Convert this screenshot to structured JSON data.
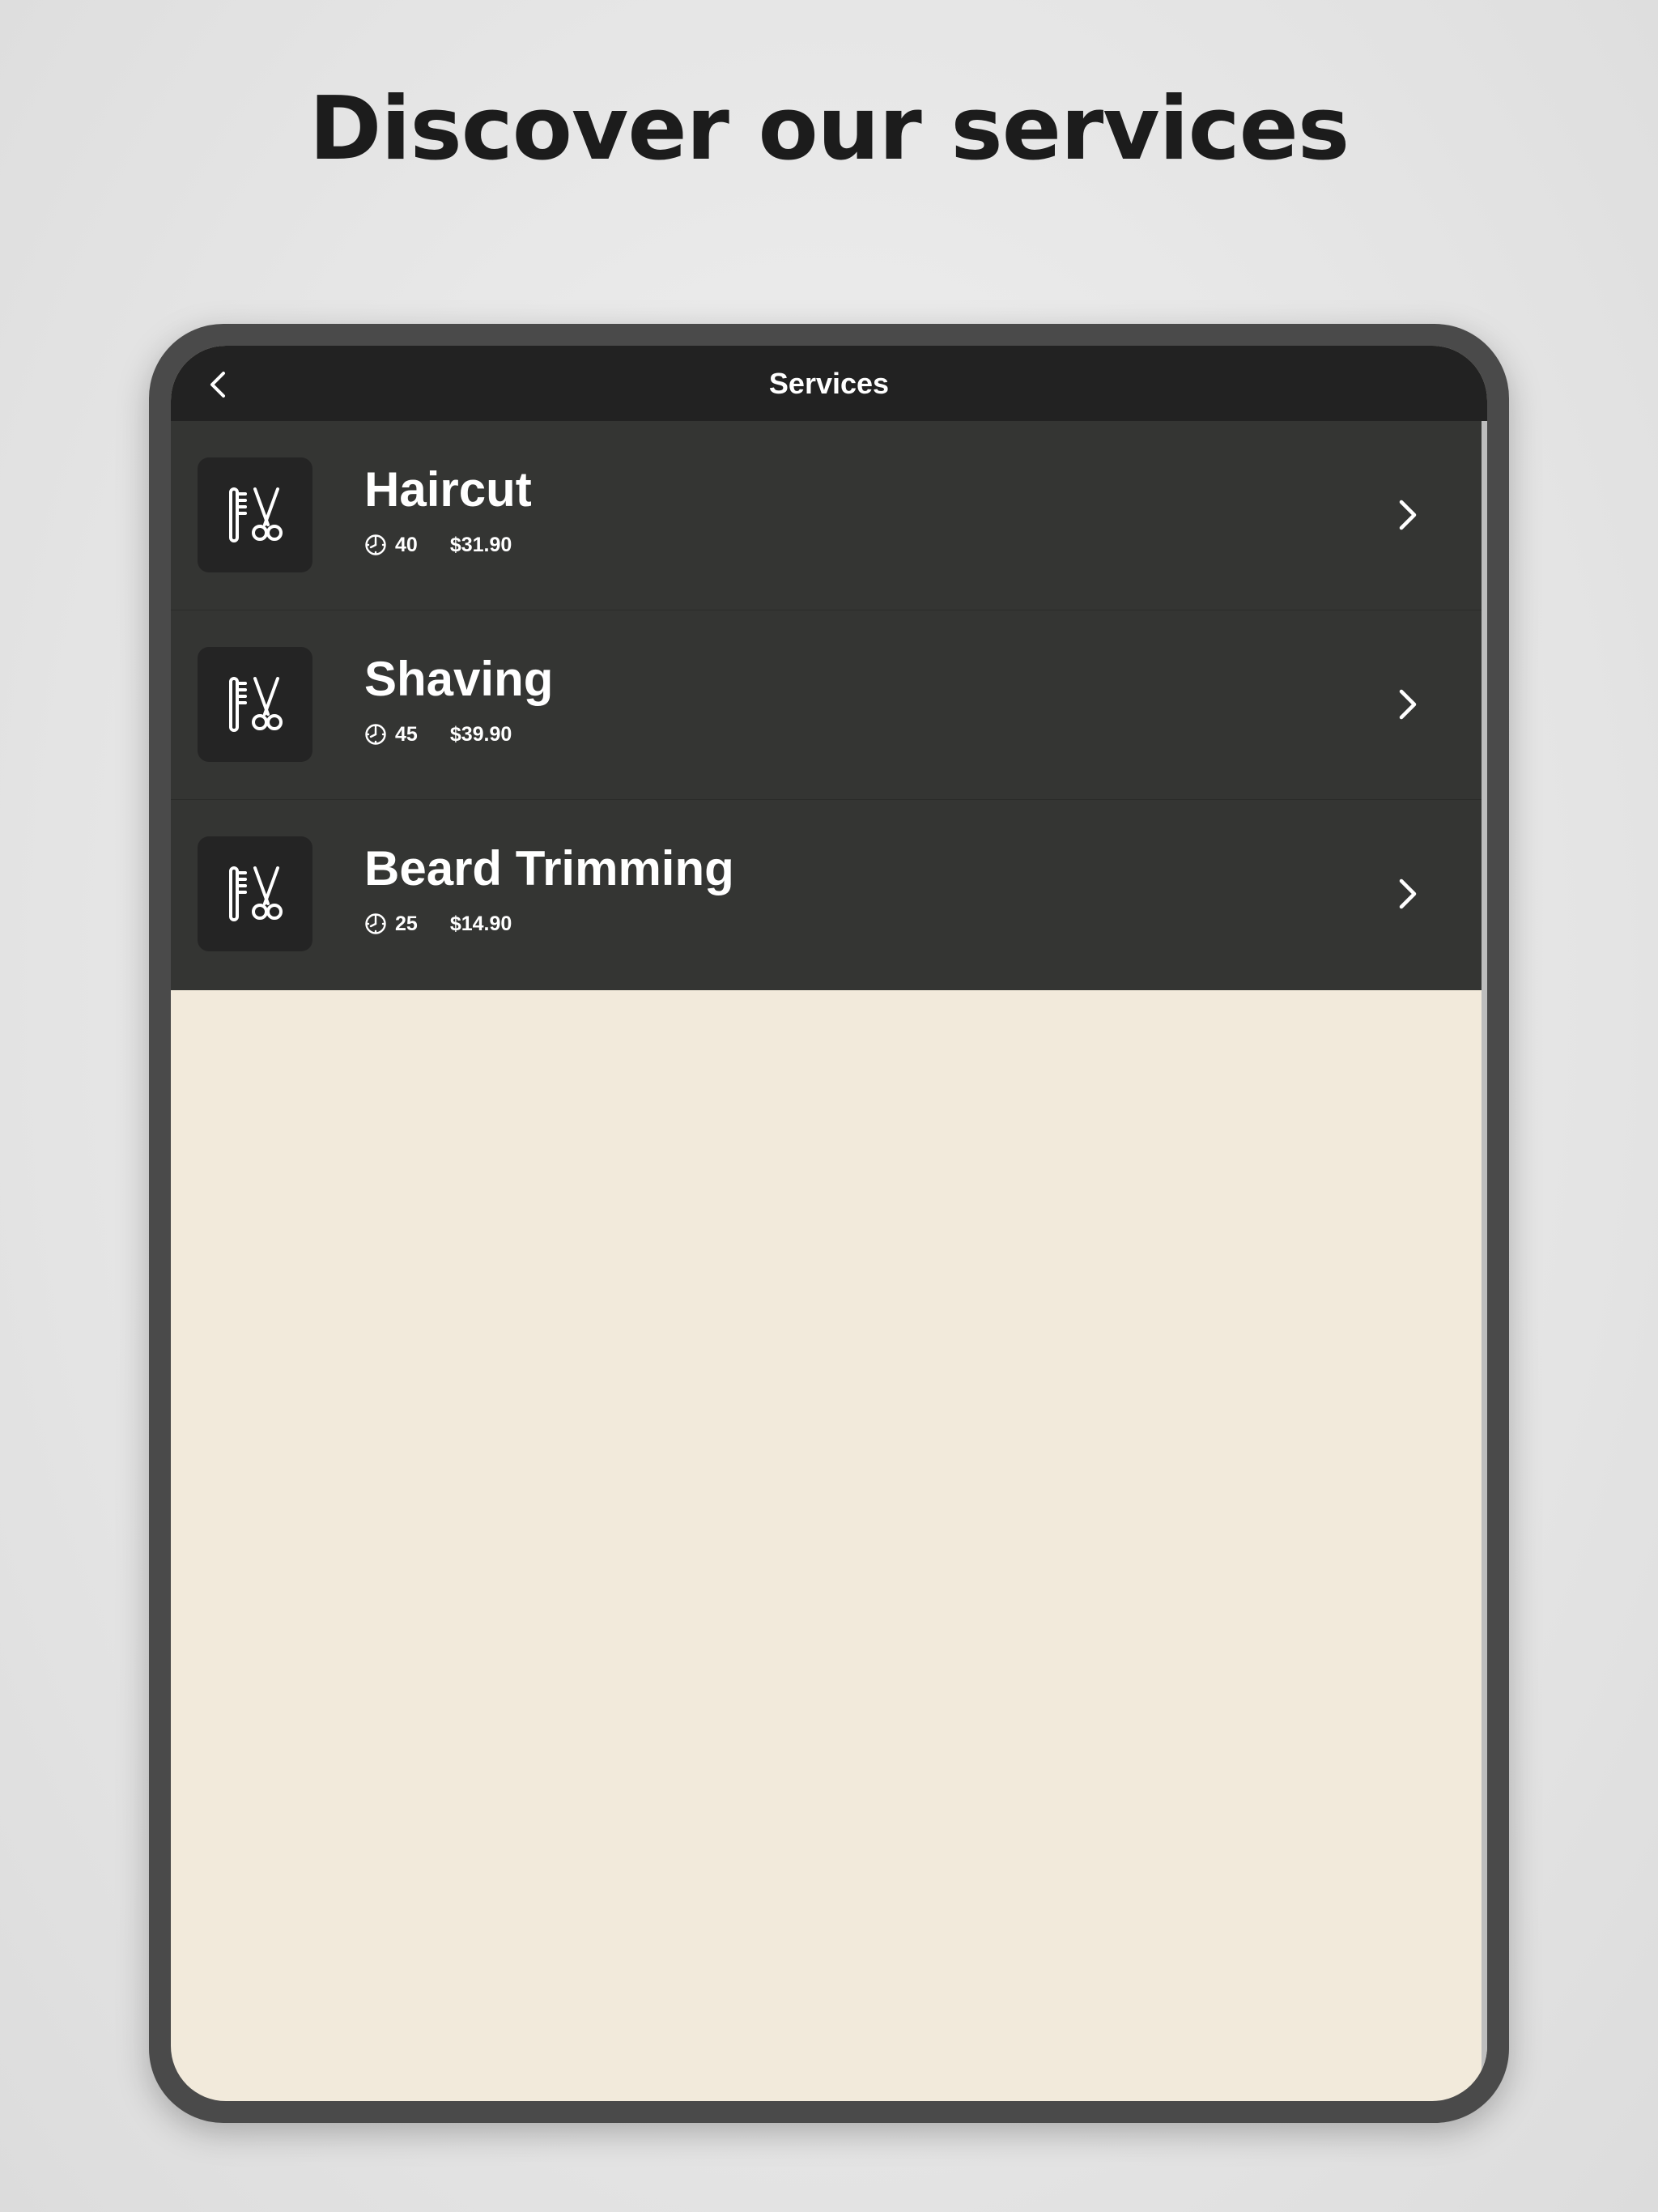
{
  "headline": "Discover our services",
  "navbar": {
    "title": "Services",
    "back_icon": "chevron-left-icon"
  },
  "services": [
    {
      "name": "Haircut",
      "duration": "40",
      "price": "$31.90",
      "icon": "comb-scissors-icon"
    },
    {
      "name": "Shaving",
      "duration": "45",
      "price": "$39.90",
      "icon": "comb-scissors-icon"
    },
    {
      "name": "Beard Trimming",
      "duration": "25",
      "price": "$14.90",
      "icon": "comb-scissors-icon"
    }
  ],
  "colors": {
    "navbar": "#222222",
    "row": "#343533",
    "thumb": "#242424",
    "screen_bg": "#f2eadb",
    "frame": "#4a4a4a"
  }
}
